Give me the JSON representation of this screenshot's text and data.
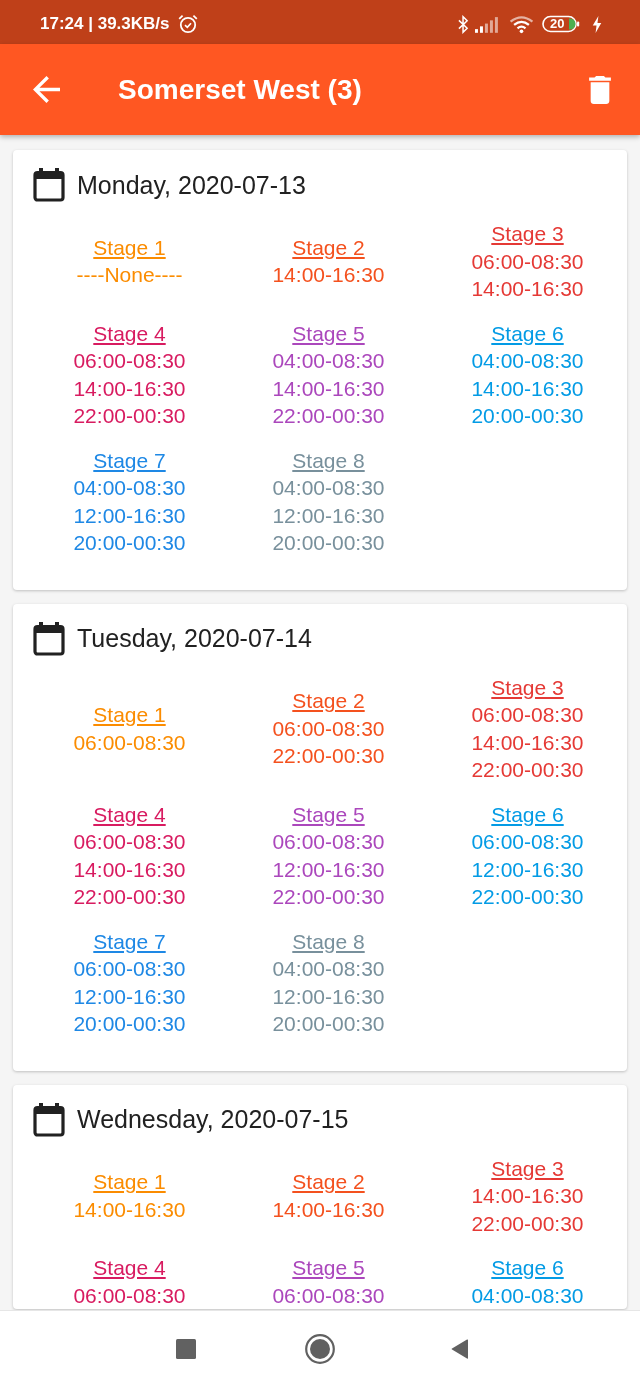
{
  "status_bar": {
    "clock_and_speed": "17:24 | 39.3KB/s",
    "battery": "20"
  },
  "app_bar": {
    "title": "Somerset West (3)"
  },
  "days": [
    {
      "date": "Monday, 2020-07-13",
      "stages": [
        {
          "label": "Stage 1",
          "color": "#fb8c00",
          "times": [
            "----None----"
          ]
        },
        {
          "label": "Stage 2",
          "color": "#f4511e",
          "times": [
            "14:00-16:30"
          ]
        },
        {
          "label": "Stage 3",
          "color": "#e53935",
          "times": [
            "06:00-08:30",
            "14:00-16:30"
          ]
        },
        {
          "label": "Stage 4",
          "color": "#d81b60",
          "times": [
            "06:00-08:30",
            "14:00-16:30",
            "22:00-00:30"
          ]
        },
        {
          "label": "Stage 5",
          "color": "#ab47bc",
          "times": [
            "04:00-08:30",
            "14:00-16:30",
            "22:00-00:30"
          ]
        },
        {
          "label": "Stage 6",
          "color": "#039be5",
          "times": [
            "04:00-08:30",
            "14:00-16:30",
            "20:00-00:30"
          ]
        },
        {
          "label": "Stage 7",
          "color": "#1e88e5",
          "times": [
            "04:00-08:30",
            "12:00-16:30",
            "20:00-00:30"
          ]
        },
        {
          "label": "Stage 8",
          "color": "#78909c",
          "times": [
            "04:00-08:30",
            "12:00-16:30",
            "20:00-00:30"
          ]
        }
      ]
    },
    {
      "date": "Tuesday, 2020-07-14",
      "stages": [
        {
          "label": "Stage 1",
          "color": "#fb8c00",
          "times": [
            "06:00-08:30"
          ]
        },
        {
          "label": "Stage 2",
          "color": "#f4511e",
          "times": [
            "06:00-08:30",
            "22:00-00:30"
          ]
        },
        {
          "label": "Stage 3",
          "color": "#e53935",
          "times": [
            "06:00-08:30",
            "14:00-16:30",
            "22:00-00:30"
          ]
        },
        {
          "label": "Stage 4",
          "color": "#d81b60",
          "times": [
            "06:00-08:30",
            "14:00-16:30",
            "22:00-00:30"
          ]
        },
        {
          "label": "Stage 5",
          "color": "#ab47bc",
          "times": [
            "06:00-08:30",
            "12:00-16:30",
            "22:00-00:30"
          ]
        },
        {
          "label": "Stage 6",
          "color": "#039be5",
          "times": [
            "06:00-08:30",
            "12:00-16:30",
            "22:00-00:30"
          ]
        },
        {
          "label": "Stage 7",
          "color": "#1e88e5",
          "times": [
            "06:00-08:30",
            "12:00-16:30",
            "20:00-00:30"
          ]
        },
        {
          "label": "Stage 8",
          "color": "#78909c",
          "times": [
            "04:00-08:30",
            "12:00-16:30",
            "20:00-00:30"
          ]
        }
      ]
    },
    {
      "date": "Wednesday, 2020-07-15",
      "stages": [
        {
          "label": "Stage 1",
          "color": "#fb8c00",
          "times": [
            "14:00-16:30"
          ]
        },
        {
          "label": "Stage 2",
          "color": "#f4511e",
          "times": [
            "14:00-16:30"
          ]
        },
        {
          "label": "Stage 3",
          "color": "#e53935",
          "times": [
            "14:00-16:30",
            "22:00-00:30"
          ]
        },
        {
          "label": "Stage 4",
          "color": "#d81b60",
          "times": [
            "06:00-08:30"
          ]
        },
        {
          "label": "Stage 5",
          "color": "#ab47bc",
          "times": [
            "06:00-08:30"
          ]
        },
        {
          "label": "Stage 6",
          "color": "#039be5",
          "times": [
            "04:00-08:30"
          ]
        }
      ]
    }
  ]
}
